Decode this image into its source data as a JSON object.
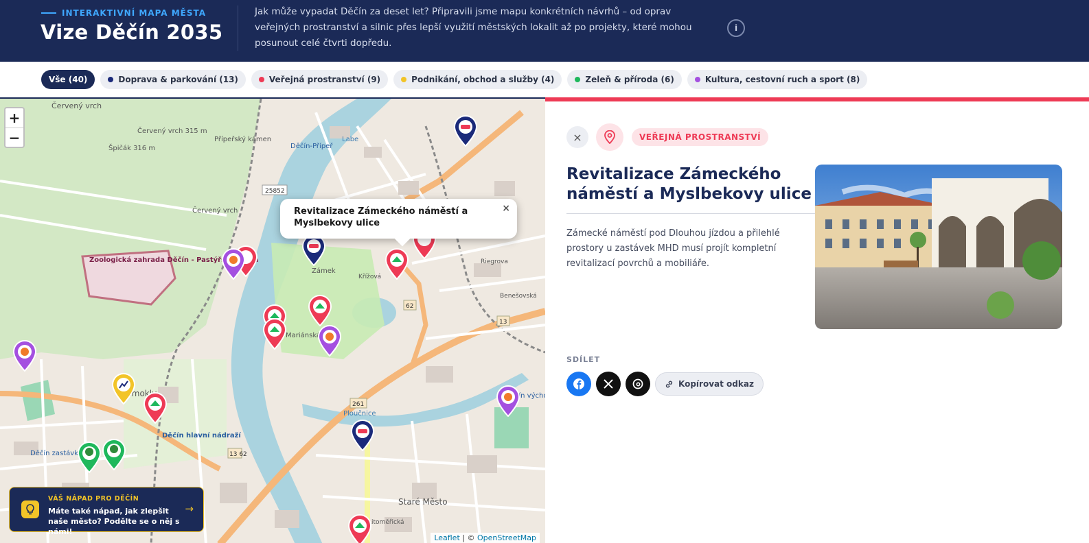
{
  "header": {
    "eyebrow": "INTERAKTIVNÍ MAPA MĚSTA",
    "title": "Vize Děčín 2035",
    "intro": "Jak může vypadat Děčín za deset let? Připravili jsme mapu konkrétních návrhů – od oprav veřejných prostranství a silnic přes lepší využití městských lokalit až po projekty, které mohou posunout celé čtvrti dopředu.",
    "info_label": "i"
  },
  "filters": [
    {
      "label": "Vše (40)",
      "color": null,
      "active": true
    },
    {
      "label": "Doprava & parkování (13)",
      "color": "#1b2a7a"
    },
    {
      "label": "Veřejná prostranství (9)",
      "color": "#ee3a55"
    },
    {
      "label": "Podnikání, obchod a služby (4)",
      "color": "#f2c428"
    },
    {
      "label": "Zeleň & příroda (6)",
      "color": "#1fb85c"
    },
    {
      "label": "Kultura, cestovní ruch a sport (8)",
      "color": "#a450e0"
    }
  ],
  "map": {
    "zoom_in": "+",
    "zoom_out": "−",
    "popup_title": "Revitalizace Zámeckého náměstí a Myslbekovy ulice",
    "popup_close": "×",
    "labels": {
      "cerveny_vrch_top": "Červený vrch",
      "cerveny_vrch_hill": "Červený vrch 315 m",
      "spicak": "Špičák 316 m",
      "pripersky": "Přípeřský kámen",
      "decin_priper": "Děčín-Přípeř",
      "road_25852": "25852",
      "cerveny_vrch_street": "Červený vrch",
      "zoo": "Zoologická zahrada Děčín - Pastýřská stěna",
      "zamek": "Zámek",
      "marianska": "Mariánská louka",
      "road_62": "62",
      "road_13": "13",
      "road_261": "261",
      "road_13_62": "13 62",
      "hlavni_nadrazi": "Děčín hlavní nádraží",
      "decin_zastavka": "Děčín zastávka",
      "stare_mesto": "Staré Město",
      "podmokly": "Podmokly",
      "labe": "Labe",
      "ploucnice": "Ploučnice",
      "litomericka": "Litoměřická",
      "decin_vychod": "Děčín východ",
      "benesovska": "Benešovská",
      "riegrova": "Riegrova",
      "krizova": "Křížová"
    },
    "pins": [
      {
        "category": "doprava",
        "color": "#1b2a7a",
        "icon": "car-icon"
      },
      {
        "category": "doprava",
        "color": "#1b2a7a",
        "icon": "car-icon"
      },
      {
        "category": "doprava",
        "color": "#1b2a7a",
        "icon": "car-icon"
      },
      {
        "category": "verejna",
        "color": "#ee3a55",
        "icon": "building-icon"
      },
      {
        "category": "verejna",
        "color": "#ee3a55",
        "icon": "building-icon"
      },
      {
        "category": "verejna",
        "color": "#ee3a55",
        "icon": "building-icon"
      },
      {
        "category": "verejna",
        "color": "#ee3a55",
        "icon": "building-icon"
      },
      {
        "category": "verejna",
        "color": "#ee3a55",
        "icon": "building-icon"
      },
      {
        "category": "verejna",
        "color": "#ee3a55",
        "icon": "building-icon"
      },
      {
        "category": "verejna",
        "color": "#ee3a55",
        "icon": "building-icon"
      },
      {
        "category": "verejna",
        "color": "#ee3a55",
        "icon": "building-icon"
      },
      {
        "category": "kultura",
        "color": "#a450e0",
        "icon": "ball-icon"
      },
      {
        "category": "kultura",
        "color": "#a450e0",
        "icon": "ball-icon"
      },
      {
        "category": "kultura",
        "color": "#a450e0",
        "icon": "ball-icon"
      },
      {
        "category": "kultura",
        "color": "#a450e0",
        "icon": "ball-icon"
      },
      {
        "category": "podnikani",
        "color": "#f2c428",
        "icon": "chart-icon"
      },
      {
        "category": "zelen",
        "color": "#1fb85c",
        "icon": "tree-icon"
      },
      {
        "category": "zelen",
        "color": "#1fb85c",
        "icon": "tree-icon"
      }
    ],
    "idea_card": {
      "eyebrow": "VÁŠ NÁPAD PRO DĚČÍN",
      "text": "Máte také nápad, jak zlepšit naše město? Podělte se o něj s námi!",
      "arrow": "→"
    },
    "attribution": {
      "leaflet": "Leaflet",
      "sep": " | © ",
      "osm": "OpenStreetMap"
    }
  },
  "detail": {
    "close_label": "×",
    "category_label": "VEŘEJNÁ PROSTRANSTVÍ",
    "title": "Revitalizace Zámeckého náměstí a Myslbekovy ulice",
    "description": "Zámecké náměstí pod Dlouhou jízdou a přilehlé prostory u zastávek MHD musí projít kompletní revitalizací povrchů a mobiliáře.",
    "share_label": "SDÍLET",
    "copy_label": "Kopírovat odkaz"
  },
  "colors": {
    "navy": "#1b2a57",
    "accent_red": "#ee3a55",
    "accent_blue": "#3fa8ff"
  }
}
